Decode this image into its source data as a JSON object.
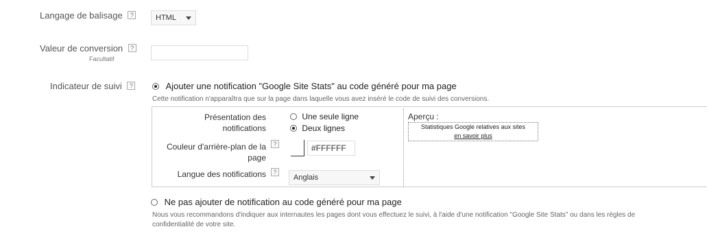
{
  "markup_language": {
    "label": "Langage de balisage",
    "help": "?",
    "value": "HTML"
  },
  "conversion_value": {
    "label": "Valeur de conversion",
    "help": "?",
    "sub_label": "Facultatif",
    "value": ""
  },
  "tracking_indicator": {
    "label": "Indicateur de suivi",
    "help": "?",
    "option_add": {
      "label": "Ajouter une notification \"Google Site Stats\" au code généré pour ma page",
      "selected": true,
      "description": "Cette notification n'apparaîtra que sur la page dans laquelle vous avez inséré le code de suivi des conversions."
    },
    "panel": {
      "presentation_label": "Présentation des notifications",
      "presentation_options": [
        {
          "label": "Une seule ligne",
          "selected": false
        },
        {
          "label": "Deux lignes",
          "selected": true
        }
      ],
      "background_label": "Couleur d'arrière-plan de la page",
      "background_help": "?",
      "background_value": "#FFFFFF",
      "language_label": "Langue des notifications",
      "language_help": "?",
      "language_value": "Anglais",
      "preview_title": "Aperçu :",
      "preview_line1": "Statistiques Google relatives aux sites",
      "preview_line2": "en savoir plus"
    },
    "option_none": {
      "label": "Ne pas ajouter de notification au code généré pour ma page",
      "selected": false,
      "description_line1": "Nous vous recommandons d'indiquer aux internautes les pages dont vous effectuez le suivi, à l'aide d'une notification \"Google Site Stats\" ou dans les règles de",
      "description_line2": "confidentialité de votre site."
    }
  }
}
